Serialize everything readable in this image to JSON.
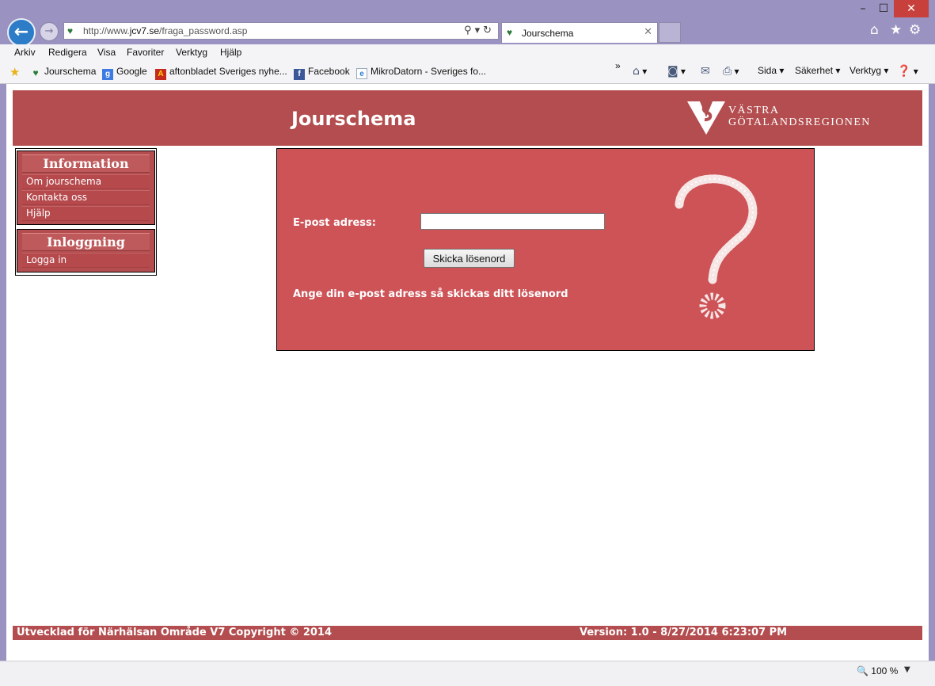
{
  "browser": {
    "url_prefix": "http://www.",
    "url_domain": "jcv7.se",
    "url_path": "/fraga_password.asp",
    "tab_title": "Jourschema",
    "menu": [
      "Arkiv",
      "Redigera",
      "Visa",
      "Favoriter",
      "Verktyg",
      "Hjälp"
    ],
    "favorites": [
      {
        "label": "Jourschema",
        "icon": "vgr-icon"
      },
      {
        "label": "Google",
        "icon": "google-icon"
      },
      {
        "label": "aftonbladet Sveriges nyhe...",
        "icon": "aftonbladet-icon"
      },
      {
        "label": "Facebook",
        "icon": "facebook-icon"
      },
      {
        "label": "MikroDatorn - Sveriges fo...",
        "icon": "ie-icon"
      }
    ],
    "commands": {
      "page": "Sida",
      "safety": "Säkerhet",
      "tools": "Verktyg"
    },
    "zoom": "100 %"
  },
  "header": {
    "title": "Jourschema",
    "logo_line1": "VÄSTRA",
    "logo_line2": "GÖTALANDSREGIONEN"
  },
  "sidebar": {
    "info_heading": "Information",
    "info_links": [
      "Om jourschema",
      "Kontakta oss",
      "Hjälp"
    ],
    "login_heading": "Inloggning",
    "login_links": [
      "Logga in"
    ]
  },
  "form": {
    "email_label": "E-post adress:",
    "email_value": "",
    "submit_label": "Skicka lösenord",
    "hint": "Ange din e-post adress så skickas ditt lösenord"
  },
  "footer": {
    "left": "Utvecklad för Närhälsan Område V7 Copyright © 2014",
    "right": "Version: 1.0 - 8/27/2014 6:23:07 PM"
  },
  "colors": {
    "header_bg": "#b34d4f",
    "panel_bg": "#cd5357",
    "chrome_bg": "#9a92c0"
  }
}
